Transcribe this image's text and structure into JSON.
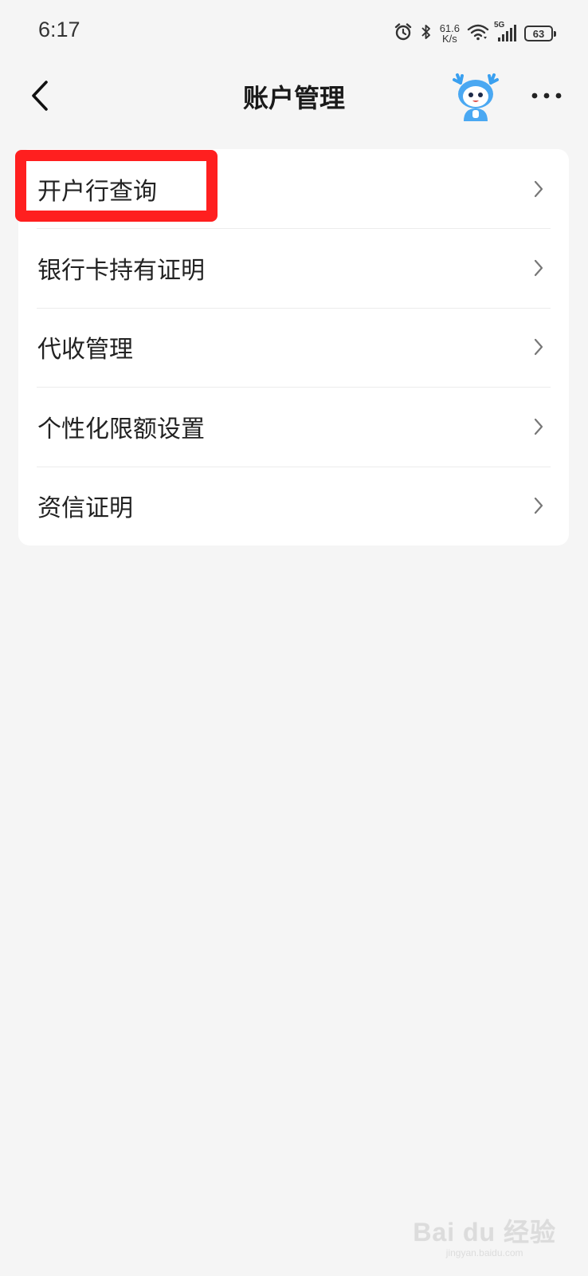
{
  "status_bar": {
    "time": "6:17",
    "net_speed_value": "61.6",
    "net_speed_unit": "K/s",
    "network_type": "5G",
    "battery_level": "63",
    "icons": [
      "alarm-icon",
      "bluetooth-icon",
      "wifi-icon",
      "signal-icon",
      "battery-icon"
    ]
  },
  "header": {
    "title": "账户管理",
    "back_icon": "chevron-left-icon",
    "avatar_icon": "mascot-avatar",
    "more_icon": "more-horizontal-icon"
  },
  "menu": {
    "items": [
      {
        "label": "开户行查询"
      },
      {
        "label": "银行卡持有证明"
      },
      {
        "label": "代收管理"
      },
      {
        "label": "个性化限额设置"
      },
      {
        "label": "资信证明"
      }
    ]
  },
  "annotation": {
    "color": "#ff1f1f",
    "target": "开户行查询"
  },
  "watermark": {
    "logo": "Bai du 经验",
    "url": "jingyan.baidu.com"
  },
  "colors": {
    "background": "#f5f5f5",
    "card": "#ffffff",
    "highlight": "#ff1f1f"
  }
}
